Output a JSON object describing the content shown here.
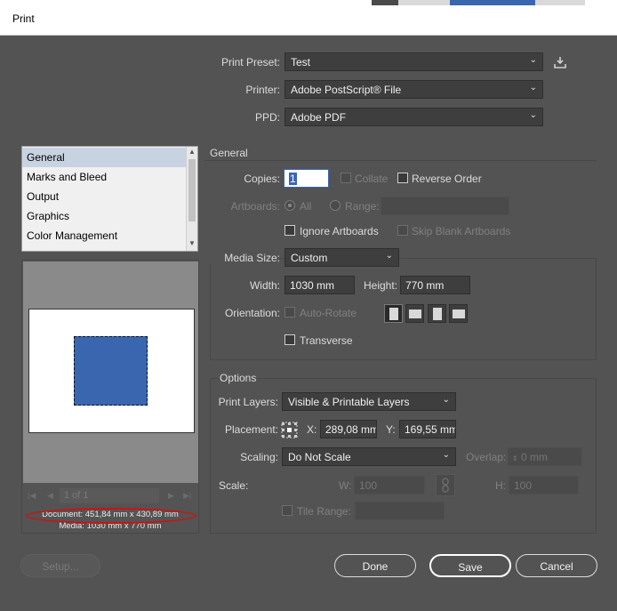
{
  "window": {
    "title": "Print"
  },
  "colors": {
    "accent": "#3a66b0",
    "background": "#535353",
    "annotation_circle": "#d01010"
  },
  "preset": {
    "label": "Print Preset:",
    "value": "Test",
    "save_icon": "save-preset-icon"
  },
  "printer": {
    "label": "Printer:",
    "value": "Adobe PostScript® File"
  },
  "ppd": {
    "label": "PPD:",
    "value": "Adobe PDF"
  },
  "sidebar": {
    "items": [
      {
        "label": "General",
        "selected": true
      },
      {
        "label": "Marks and Bleed"
      },
      {
        "label": "Output"
      },
      {
        "label": "Graphics"
      },
      {
        "label": "Color Management"
      }
    ]
  },
  "general": {
    "section_title": "General",
    "copies_label": "Copies:",
    "copies_value": "1",
    "collate_label": "Collate",
    "reverse_order_label": "Reverse Order",
    "artboards_label": "Artboards:",
    "all_label": "All",
    "range_label": "Range:",
    "ignore_artboards_label": "Ignore Artboards",
    "skip_blank_label": "Skip Blank Artboards"
  },
  "media": {
    "size_label": "Media Size:",
    "size_value": "Custom",
    "width_label": "Width:",
    "width_value": "1030 mm",
    "height_label": "Height:",
    "height_value": "770 mm",
    "orientation_label": "Orientation:",
    "auto_rotate_label": "Auto-Rotate",
    "transverse_label": "Transverse"
  },
  "options": {
    "section_title": "Options",
    "print_layers_label": "Print Layers:",
    "print_layers_value": "Visible & Printable Layers",
    "placement_label": "Placement:",
    "x_label": "X:",
    "x_value": "289,08 mm",
    "y_label": "Y:",
    "y_value": "169,55 mm",
    "scaling_label": "Scaling:",
    "scaling_value": "Do Not Scale",
    "overlap_label": "Overlap:",
    "overlap_value": "0 mm",
    "scale_label": "Scale:",
    "w_label": "W:",
    "w_value": "100",
    "h_label": "H:",
    "h_value": "100",
    "tile_range_label": "Tile Range:"
  },
  "preview": {
    "page_indicator": "1 of 1",
    "document_info": "Document: 451,84 mm x 430,89 mm",
    "media_info": "Media: 1030 mm x 770 mm"
  },
  "buttons": {
    "setup": "Setup...",
    "done": "Done",
    "save": "Save",
    "cancel": "Cancel"
  }
}
